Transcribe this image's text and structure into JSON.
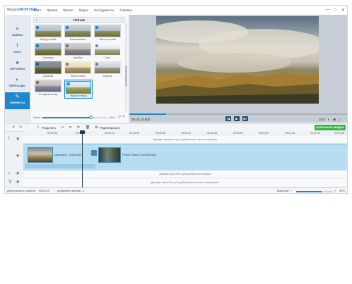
{
  "app": {
    "title_prefix": "Видео",
    "title_suffix": "МОНТАЖ",
    "menu": [
      "Файл",
      "Правка",
      "Проект",
      "Видео",
      "Инструменты",
      "Справка"
    ],
    "window_controls": [
      "—",
      "□",
      "✕"
    ]
  },
  "sidebar": {
    "items": [
      {
        "icon": "≡",
        "label": "ФАЙЛЫ"
      },
      {
        "icon": "T",
        "label": "ТЕКСТ"
      },
      {
        "icon": "★",
        "label": "КАРТИНКИ"
      },
      {
        "icon": "◐",
        "label": "ПЕРЕХОДЫ"
      },
      {
        "icon": "✎",
        "label": "ЭФФЕКТЫ"
      }
    ]
  },
  "effects": {
    "category": "Пейзаж",
    "prev_arrow": "‹",
    "next_arrow": "›",
    "thumbs": [
      "Перед грозой",
      "Ранняя весна",
      "Свет по краям",
      "Озичение",
      "Серебро",
      "Снег",
      "Сумерки",
      "Теплое небо",
      "Тишина",
      "Холодный вечер",
      "Яркое солнце"
    ],
    "strength_label": "Сила:",
    "strength_value": "74%",
    "strength_fraction": 0.74
  },
  "preview": {
    "timecode": "00:00:15.800",
    "ratio": "16:9",
    "controls": [
      "|◀",
      "▶",
      "▶|"
    ],
    "progress_fraction": 0.17
  },
  "toolbar": {
    "split_label": "Разделить",
    "edit_label": "Редактировать",
    "save_label": "СОХРАНИТЬ ВИДЕО"
  },
  "timeline": {
    "ticks": [
      "00:00:06",
      "00:00:12",
      "00:00:18",
      "00:00:24",
      "00:00:30",
      "00:00:36",
      "00:00:42",
      "00:00:48",
      "00:00:54",
      "00:01:00",
      "00:01:06",
      "00:01:12",
      "00:01:18",
      "00:01:24",
      "00:01:30"
    ],
    "text_hint": "Дважды щелкните для добавления текста и графики",
    "music_hint": "Дважды щелкните для добавления музыки",
    "mic_hint": "Дважды щелкните для добавления записи с микрофона",
    "clip1": "Mountains - 2296.mp4",
    "clip2": "Pexels Videos 2149800.mp4"
  },
  "status": {
    "duration_label": "Длительность проекта:",
    "duration_value": "00:01:44",
    "clips_label": "Добавлено клипов:",
    "clips_value": "2",
    "zoom_label": "Масштаб:",
    "zoom_value": "42%"
  }
}
